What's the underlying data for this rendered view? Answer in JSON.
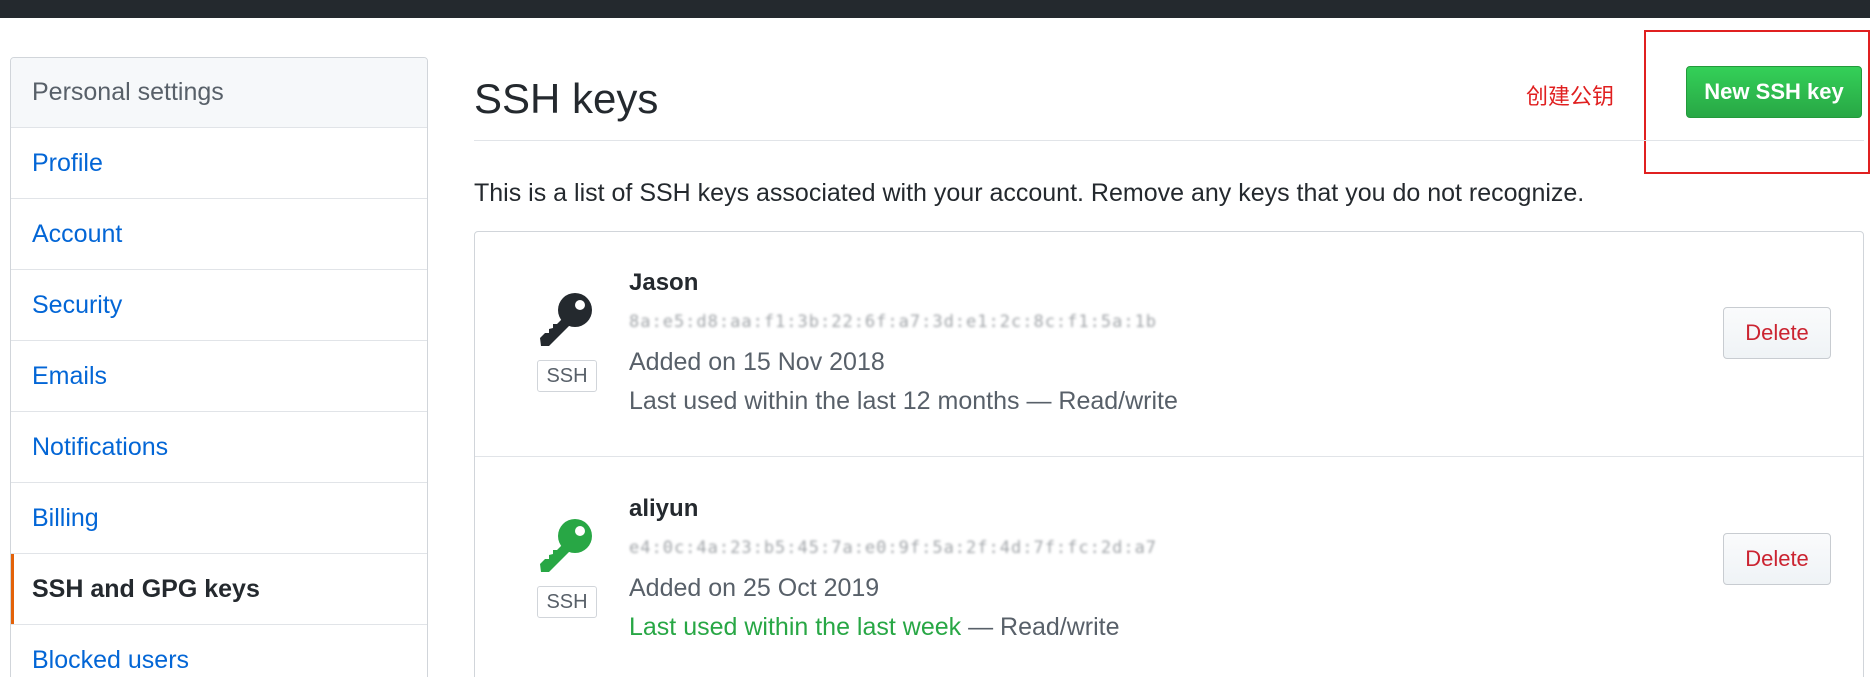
{
  "sidebar": {
    "header": "Personal settings",
    "items": [
      {
        "label": "Profile"
      },
      {
        "label": "Account"
      },
      {
        "label": "Security"
      },
      {
        "label": "Emails"
      },
      {
        "label": "Notifications"
      },
      {
        "label": "Billing"
      },
      {
        "label": "SSH and GPG keys",
        "selected": true
      },
      {
        "label": "Blocked users"
      }
    ]
  },
  "main": {
    "title": "SSH keys",
    "annotation": "创建公钥",
    "new_button": "New SSH key",
    "description": "This is a list of SSH keys associated with your account. Remove any keys that you do not recognize.",
    "keys": [
      {
        "name": "Jason",
        "fingerprint": "8a:e5:d8:aa:f1:3b:22:6f:a7:3d:e1:2c:8c:f1:5a:1b",
        "badge": "SSH",
        "added": "Added on 15 Nov 2018",
        "last_used": "Last used within the last 12 months",
        "last_used_suffix": " — Read/write",
        "icon": "key-icon",
        "icon_color": "#24292e",
        "delete_label": "Delete"
      },
      {
        "name": "aliyun",
        "fingerprint": "e4:0c:4a:23:b5:45:7a:e0:9f:5a:2f:4d:7f:fc:2d:a7",
        "badge": "SSH",
        "added": "Added on 25 Oct 2019",
        "last_used": "Last used within the last week",
        "last_used_suffix": " — Read/write",
        "icon": "key-icon",
        "icon_color": "#28a745",
        "delete_label": "Delete"
      }
    ]
  },
  "colors": {
    "accent": "#0366d6",
    "primary_button": "#28a745",
    "danger": "#cb2431",
    "annotation": "#e02020",
    "selected_marker": "#e36209"
  }
}
